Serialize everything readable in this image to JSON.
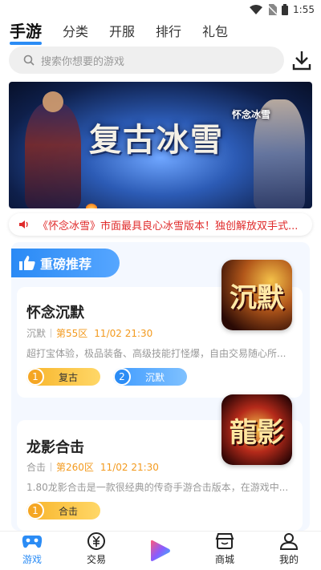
{
  "status_bar": {
    "time": "1:55"
  },
  "top_tabs": [
    {
      "label": "手游",
      "active": true
    },
    {
      "label": "分类"
    },
    {
      "label": "开服"
    },
    {
      "label": "排行"
    },
    {
      "label": "礼包"
    }
  ],
  "search": {
    "placeholder": "搜索你想要的游戏"
  },
  "banner": {
    "title": "复古冰雪",
    "logo_text": "怀念冰雪"
  },
  "notice": {
    "text": "《怀念冰雪》市面最具良心冰雪版本！独创解放双手式..."
  },
  "recommend": {
    "header": "重磅推荐",
    "items": [
      {
        "name": "怀念沉默",
        "tag": "沉默",
        "zone": "第55区",
        "time": "11/02 21:30",
        "desc": "超打宝体验，极品装备、高级技能打怪爆，自由交易随心所...",
        "icon_text": "沉默",
        "buttons": [
          {
            "num": "1",
            "label": "复古",
            "style": "gold"
          },
          {
            "num": "2",
            "label": "沉默",
            "style": "blue"
          }
        ]
      },
      {
        "name": "龙影合击",
        "tag": "合击",
        "zone": "第260区",
        "time": "11/02 21:30",
        "desc": "1.80龙影合击是一款很经典的传奇手游合击版本，在游戏中...",
        "icon_text": "龍影",
        "buttons": [
          {
            "num": "1",
            "label": "合击",
            "style": "gold"
          }
        ]
      }
    ]
  },
  "bottom_nav": [
    {
      "label": "游戏",
      "icon": "gamepad-icon",
      "active": true
    },
    {
      "label": "交易",
      "icon": "trade-icon"
    },
    {
      "label": "",
      "icon": "play-icon"
    },
    {
      "label": "商城",
      "icon": "shop-icon"
    },
    {
      "label": "我的",
      "icon": "user-icon"
    }
  ],
  "colors": {
    "accent": "#2b8cf5",
    "notice_red": "#e02b2b",
    "zone_orange": "#f39a1e"
  }
}
